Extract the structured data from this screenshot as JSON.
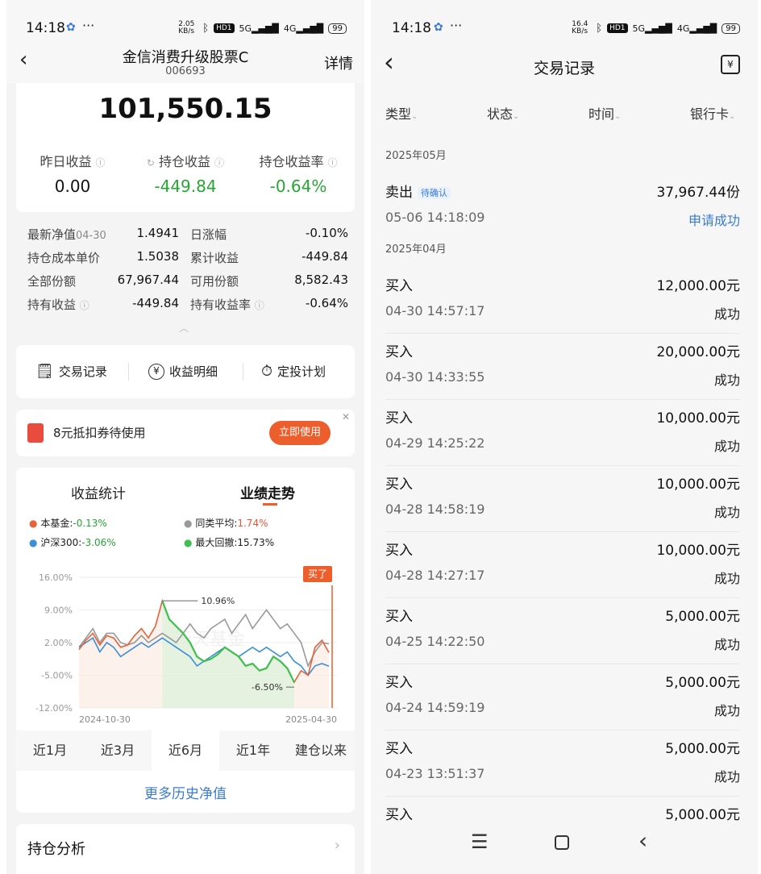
{
  "status_left": {
    "time": "14:18",
    "speed": "2.05 KB/s",
    "battery": "99"
  },
  "status_right": {
    "time": "14:18",
    "speed": "16.4 KB/s",
    "battery": "99"
  },
  "fund": {
    "name": "金信消费升级股票C",
    "code": "006693",
    "detail_label": "详情",
    "amount": "101,550.15",
    "stats": [
      {
        "label": "昨日收益",
        "value": "0.00"
      },
      {
        "label": "持仓收益",
        "value": "-449.84"
      },
      {
        "label": "持仓收益率",
        "value": "-0.64%"
      }
    ],
    "details": [
      {
        "label": "最新净值",
        "sub": "04-30",
        "value": "1.4941",
        "label2": "日涨幅",
        "value2": "-0.10%"
      },
      {
        "label": "持仓成本单价",
        "value": "1.5038",
        "label2": "累计收益",
        "value2": "-449.84"
      },
      {
        "label": "全部份额",
        "value": "67,967.44",
        "label2": "可用份额",
        "value2": "8,582.43"
      },
      {
        "label": "持有收益",
        "value": "-449.84",
        "label2": "持有收益率",
        "value2": "-0.64%"
      }
    ]
  },
  "actions": {
    "records": "交易记录",
    "income": "收益明细",
    "plan": "定投计划"
  },
  "coupon": {
    "text": "8元抵扣券待使用",
    "button": "立即使用"
  },
  "chart_tabs": {
    "stats": "收益统计",
    "trend": "业绩走势"
  },
  "legend": [
    {
      "name": "本基金:",
      "value": "-0.13%",
      "color": "#e5633b",
      "value_color": "#27a634"
    },
    {
      "name": "同类平均:",
      "value": "1.74%",
      "color": "#999999",
      "value_color": "#e5543b"
    },
    {
      "name": "沪深300:",
      "value": "-3.06%",
      "color": "#3a8fd8",
      "value_color": "#27a634"
    },
    {
      "name": "最大回撤:",
      "value": "15.73%",
      "color": "#3fbf4f",
      "value_color": "#444444"
    }
  ],
  "chart_data": {
    "type": "line",
    "y_ticks": [
      "16.00%",
      "9.00%",
      "2.00%",
      "-5.00%",
      "-12.00%"
    ],
    "ylim": [
      -12,
      16
    ],
    "x_start": "2024-10-30",
    "x_end": "2025-04-30",
    "annotations": {
      "peak": "10.96%",
      "trough": "-6.50%",
      "buy": "买了"
    },
    "watermark": "天天基金",
    "series": [
      {
        "name": "本基金",
        "color": "#e5633b",
        "values": [
          0.5,
          2.5,
          4,
          1.5,
          3.5,
          3,
          1,
          1.5,
          3.5,
          5,
          3,
          5.5,
          10.96,
          7,
          5.5,
          4,
          2,
          -1,
          -2,
          -1.5,
          -0.5,
          1,
          0,
          -1,
          -3,
          -2.5,
          -4,
          -3.5,
          -1,
          -2,
          -3.5,
          -6.5,
          -4,
          -5,
          1,
          2.5,
          -0.13
        ]
      },
      {
        "name": "同类平均",
        "color": "#999999",
        "values": [
          1,
          3,
          5,
          2,
          4,
          4,
          2,
          1.5,
          2,
          3.5,
          2,
          3,
          4,
          3,
          2,
          4,
          6,
          4,
          3,
          5,
          6,
          7,
          4,
          6,
          8,
          5,
          7,
          9,
          7,
          5,
          6,
          4,
          2,
          -3,
          0,
          2,
          1.74
        ]
      },
      {
        "name": "沪深300",
        "color": "#3a8fd8",
        "values": [
          1,
          2,
          3,
          0,
          2,
          1,
          -1,
          0,
          1,
          2,
          1,
          2,
          3,
          2,
          1,
          0,
          -1,
          -3,
          -2,
          -1,
          0,
          1,
          0,
          -1,
          0,
          1,
          0,
          1,
          0,
          -1,
          0,
          -2,
          -3,
          -5,
          -3,
          -2.5,
          -3.06
        ]
      }
    ]
  },
  "ranges": [
    "近1月",
    "近3月",
    "近6月",
    "近1年",
    "建仓以来"
  ],
  "more_nav": "更多历史净值",
  "holding_analysis": "持仓分析",
  "records_page": {
    "title": "交易记录",
    "filters": [
      "类型",
      "状态",
      "时间",
      "银行卡"
    ],
    "months": [
      {
        "month": "2025年05月",
        "items": [
          {
            "type": "卖出",
            "tag": "待确认",
            "amount": "37,967.44份",
            "time": "05-06 14:18:09",
            "status": "申请成功",
            "status_blue": true
          }
        ]
      },
      {
        "month": "2025年04月",
        "items": [
          {
            "type": "买入",
            "amount": "12,000.00元",
            "time": "04-30 14:57:17",
            "status": "成功"
          },
          {
            "type": "买入",
            "amount": "20,000.00元",
            "time": "04-30 14:33:55",
            "status": "成功"
          },
          {
            "type": "买入",
            "amount": "10,000.00元",
            "time": "04-29 14:25:22",
            "status": "成功"
          },
          {
            "type": "买入",
            "amount": "10,000.00元",
            "time": "04-28 14:58:19",
            "status": "成功"
          },
          {
            "type": "买入",
            "amount": "10,000.00元",
            "time": "04-28 14:27:17",
            "status": "成功"
          },
          {
            "type": "买入",
            "amount": "5,000.00元",
            "time": "04-25 14:22:50",
            "status": "成功"
          },
          {
            "type": "买入",
            "amount": "5,000.00元",
            "time": "04-24 14:59:19",
            "status": "成功"
          },
          {
            "type": "买入",
            "amount": "5,000.00元",
            "time": "04-23 13:51:37",
            "status": "成功"
          },
          {
            "type": "买入",
            "amount": "5,000.00元",
            "time": "",
            "status": ""
          }
        ]
      }
    ]
  }
}
